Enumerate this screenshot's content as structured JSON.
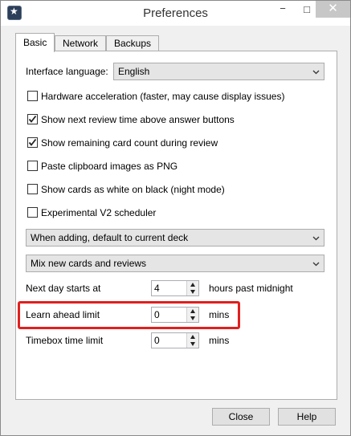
{
  "window": {
    "title": "Preferences"
  },
  "titlebar": {
    "minimize_glyph": "−",
    "maximize_glyph": "□",
    "close_glyph": "✕",
    "app_icon": "app-icon"
  },
  "tabs": [
    {
      "label": "Basic",
      "active": true
    },
    {
      "label": "Network",
      "active": false
    },
    {
      "label": "Backups",
      "active": false
    }
  ],
  "basic": {
    "interface_language_label": "Interface language:",
    "interface_language_value": "English",
    "checkboxes": [
      {
        "label": "Hardware acceleration (faster, may cause display issues)",
        "checked": false
      },
      {
        "label": "Show next review time above answer buttons",
        "checked": true
      },
      {
        "label": "Show remaining card count during review",
        "checked": true
      },
      {
        "label": "Paste clipboard images as PNG",
        "checked": false
      },
      {
        "label": "Show cards as white on black (night mode)",
        "checked": false
      },
      {
        "label": "Experimental V2 scheduler",
        "checked": false
      }
    ],
    "deck_default_value": "When adding, default to current deck",
    "new_review_mix_value": "Mix new cards and reviews",
    "next_day_label": "Next day starts at",
    "next_day_value": "4",
    "next_day_unit": "hours past midnight",
    "learn_ahead_label": "Learn ahead limit",
    "learn_ahead_value": "0",
    "learn_ahead_unit": "mins",
    "timebox_label": "Timebox time limit",
    "timebox_value": "0",
    "timebox_unit": "mins"
  },
  "footer": {
    "close_label": "Close",
    "help_label": "Help"
  },
  "colors": {
    "highlight": "#e0201f"
  }
}
